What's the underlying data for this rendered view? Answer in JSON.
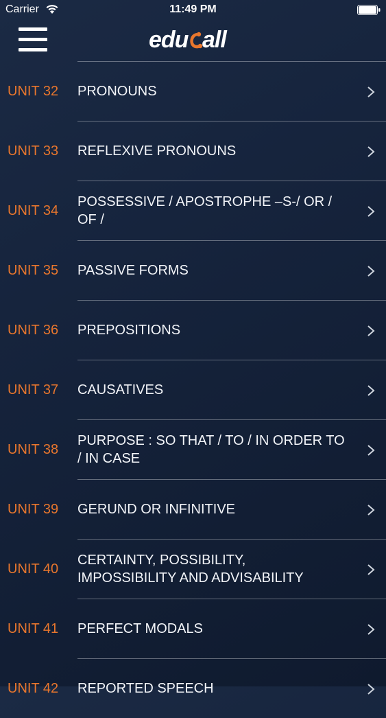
{
  "status_bar": {
    "carrier": "Carrier",
    "time": "11:49 PM"
  },
  "nav": {
    "logo_text": "eduCall",
    "menu_icon": "hamburger-menu-icon"
  },
  "units": [
    {
      "unit": "UNIT 32",
      "title": "PRONOUNS"
    },
    {
      "unit": "UNIT 33",
      "title": "REFLEXIVE PRONOUNS"
    },
    {
      "unit": "UNIT 34",
      "title": "POSSESSIVE / APOSTROPHE –S-/ OR / OF /"
    },
    {
      "unit": "UNIT 35",
      "title": "PASSIVE FORMS"
    },
    {
      "unit": "UNIT 36",
      "title": "PREPOSITIONS"
    },
    {
      "unit": "UNIT 37",
      "title": "CAUSATIVES"
    },
    {
      "unit": "UNIT 38",
      "title": "PURPOSE : SO THAT / TO / IN ORDER TO / IN CASE"
    },
    {
      "unit": "UNIT 39",
      "title": "GERUND OR INFINITIVE"
    },
    {
      "unit": "UNIT 40",
      "title": "CERTAINTY, POSSIBILITY, IMPOSSIBILITY AND ADVISABILITY"
    },
    {
      "unit": "UNIT 41",
      "title": "PERFECT MODALS"
    },
    {
      "unit": "UNIT 42",
      "title": "REPORTED SPEECH"
    }
  ],
  "colors": {
    "accent": "#e8762d",
    "background": "#16243d",
    "text": "#f2f4f8"
  }
}
